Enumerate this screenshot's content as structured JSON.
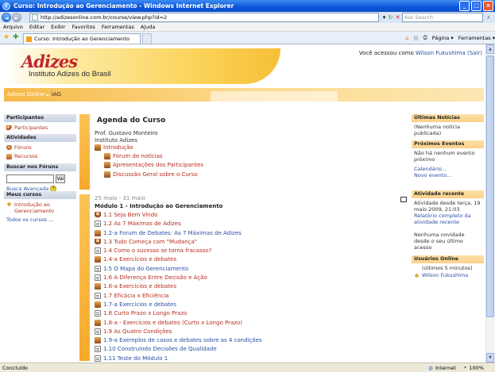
{
  "window": {
    "title": "Curso: Introdução ao Gerenciamento - Windows Internet Explorer"
  },
  "address": {
    "url": "http://adizesonline.com.br/course/view.php?id=2",
    "search_placeholder": "Ask Search"
  },
  "menu": [
    "Arquivo",
    "Editar",
    "Exibir",
    "Favoritos",
    "Ferramentas",
    "Ajuda"
  ],
  "tab": {
    "label": "Curso: Introdução ao Gerenciamento"
  },
  "toolbar": {
    "page_label": "Página ▾",
    "tools_label": "Ferramentas ▾"
  },
  "header": {
    "logo_text": "Adizes",
    "logo_subtitle": "Instituto Adizes do Brasil",
    "login_prefix": "Você acessou como",
    "user_name": "Wilson Fukushima",
    "logout": "(Sair)"
  },
  "breadcrumb": {
    "home": "Adizes Online",
    "separator": "►",
    "current": "IAG"
  },
  "left": {
    "participants": {
      "title": "Participantes",
      "item": "Participantes"
    },
    "activities": {
      "title": "Atividades",
      "items": [
        "Fóruns",
        "Recursos"
      ]
    },
    "forum_search": {
      "title": "Buscar nos Fóruns",
      "button": "Vai",
      "advanced": "Busca Avançada",
      "help": "?"
    },
    "my_courses": {
      "title": "Meus cursos",
      "course": "Introdução ao Gerenciamento",
      "all": "Todos os cursos ..."
    }
  },
  "center": {
    "title": "Agenda do Curso",
    "section0": {
      "teacher": "Prof. Gustavo Monteiro",
      "org": "Instituto Adizes",
      "intro_link": "Introdução",
      "items": [
        "Fórum de notícias",
        "Apresentações dos Participantes",
        "Discussão Geral sobre o Curso"
      ]
    },
    "section1": {
      "dates": "25 maio - 31 maio",
      "title": "Módulo 1 - Introdução ao Gerenciamento",
      "items": [
        {
          "label": "1.1 Seja Bem Vindo",
          "icon": "user-icon",
          "kind": "red"
        },
        {
          "label": "1.2 As 7 Máximas de Adizes",
          "icon": "doc-icon",
          "kind": "red"
        },
        {
          "label": "1.2-a Forum de Debates: As 7 Máximas de Adizes",
          "icon": "forum-icon",
          "kind": "blue"
        },
        {
          "label": "1.3 Tudo Começa com \"Mudança\"",
          "icon": "user-icon",
          "kind": "red"
        },
        {
          "label": "1.4 Como o sucesso se torna fracasso?",
          "icon": "doc-icon",
          "kind": "red"
        },
        {
          "label": "1.4-a Exercícios e debates",
          "icon": "forum-icon",
          "kind": "red"
        },
        {
          "label": "1.5 O Mapa do Gerenciamento",
          "icon": "doc-icon",
          "kind": "blue"
        },
        {
          "label": "1.6 A Diferença Entre Decisão e Ação",
          "icon": "doc-icon",
          "kind": "red"
        },
        {
          "label": "1.6-a Exercícios e debates",
          "icon": "forum-icon",
          "kind": "red"
        },
        {
          "label": "1.7 Eficácia x Eficiência",
          "icon": "doc-icon",
          "kind": "red"
        },
        {
          "label": "1.7-a Exercícios e debates",
          "icon": "forum-icon",
          "kind": "blue"
        },
        {
          "label": "1.8 Curto Prazo x Longo Prazo",
          "icon": "doc-icon",
          "kind": "red"
        },
        {
          "label": "1.8-a - Exercícios e debates (Curto x Longo Prazo)",
          "icon": "forum-icon",
          "kind": "red"
        },
        {
          "label": "1.9 As Quatro Condições",
          "icon": "doc-icon",
          "kind": "red"
        },
        {
          "label": "1.9-a Exemplos de casos e debates sobre as 4 condições",
          "icon": "forum-icon",
          "kind": "blue"
        },
        {
          "label": "1.10 Construindo Decisões de Qualidade",
          "icon": "doc-icon",
          "kind": "blue"
        },
        {
          "label": "1.11 Teste do Módulo 1",
          "icon": "doc-icon",
          "kind": "blue"
        }
      ]
    }
  },
  "right": {
    "news": {
      "title": "Últimas Notícias",
      "body": "(Nenhuma notícia publicada)"
    },
    "events": {
      "title": "Próximos Eventos",
      "none": "Não há nenhum evento próximo",
      "calendar": "Calendário...",
      "new_event": "Novo evento..."
    },
    "recent": {
      "title": "Atividade recente",
      "since": "Atividade desde terça, 19 maio 2009, 21:03",
      "report": "Relatório completo da atividade recente",
      "none": "Nenhuma novidade desde o seu último acesso"
    },
    "online": {
      "title": "Usuários Online",
      "window": "(últimos 5 minutos)",
      "user": "Wilson Fukushima"
    }
  },
  "status": {
    "left": "Concluído",
    "zone": "Internet",
    "zoom": "100%"
  }
}
